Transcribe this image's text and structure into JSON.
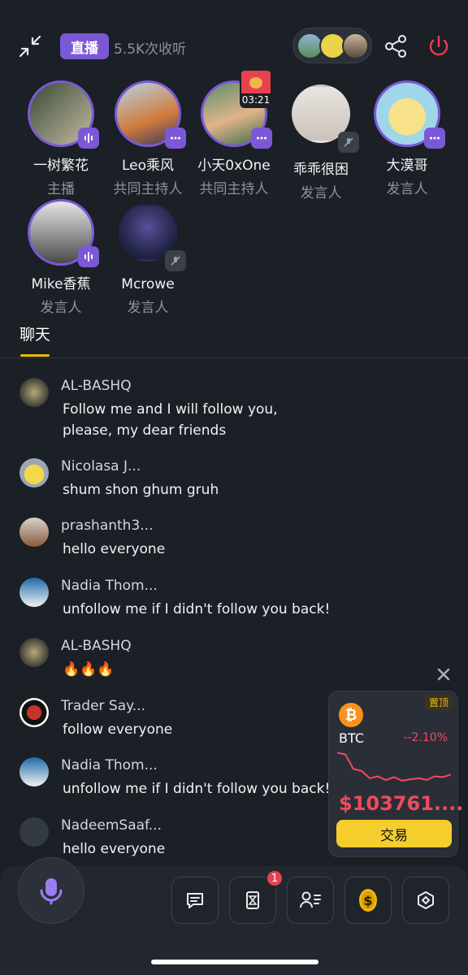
{
  "header": {
    "live_label": "直播",
    "listen_count": "5.5K次收听",
    "icons": [
      "minimize-icon",
      "share-icon",
      "power-icon"
    ]
  },
  "speakers": [
    {
      "name": "一树繁花",
      "role": "主播",
      "status": "speaking"
    },
    {
      "name": "Leo乘风",
      "role": "共同主持人",
      "status": "more"
    },
    {
      "name": "小天0xOne",
      "role": "共同主持人",
      "status": "more",
      "timer": "03:21"
    },
    {
      "name": "乖乖很困",
      "role": "发言人",
      "status": "muted"
    },
    {
      "name": "大漠哥",
      "role": "发言人",
      "status": "more"
    },
    {
      "name": "Mike香蕉",
      "role": "发言人",
      "status": "speaking"
    },
    {
      "name": "Mcrowe",
      "role": "发言人",
      "status": "muted"
    }
  ],
  "tabs": {
    "chat": "聊天"
  },
  "chat": [
    {
      "user": "AL-BASHQ",
      "text": "Follow me and I will follow you, please, my dear friends"
    },
    {
      "user": "Nicolasa J...",
      "text": "shum shon ghum gruh"
    },
    {
      "user": "prashanth3...",
      "text": "hello everyone"
    },
    {
      "user": "Nadia Thom...",
      "text": "unfollow me if I didn't follow you back!"
    },
    {
      "user": "AL-BASHQ",
      "text": "🔥🔥🔥"
    },
    {
      "user": "Trader Say...",
      "text": "follow everyone"
    },
    {
      "user": "Nadia Thom...",
      "text": "unfollow me if I didn't follow you back!"
    },
    {
      "user": "NadeemSaaf...",
      "text": "hello everyone"
    }
  ],
  "btc_widget": {
    "pin_label": "置顶",
    "symbol": "BTC",
    "change": "--2.10%",
    "price": "$103761....",
    "trade_label": "交易",
    "trend": [
      0.95,
      0.9,
      0.5,
      0.45,
      0.25,
      0.3,
      0.2,
      0.28,
      0.18,
      0.22,
      0.25,
      0.2,
      0.3,
      0.28,
      0.35
    ],
    "accent": "#f04a5e"
  },
  "bottom": {
    "badge_count": "1",
    "icons": [
      "mic-icon",
      "chat-bubble-icon",
      "hourglass-icon",
      "user-list-icon",
      "coin-icon",
      "box-icon"
    ]
  }
}
